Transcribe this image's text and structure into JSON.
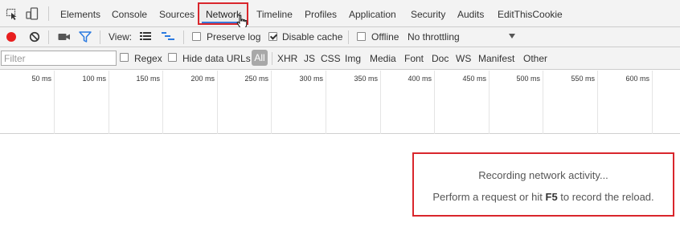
{
  "tabs": {
    "elements": "Elements",
    "console": "Console",
    "sources": "Sources",
    "network": "Network",
    "timeline": "Timeline",
    "profiles": "Profiles",
    "application": "Application",
    "security": "Security",
    "audits": "Audits",
    "editthiscookie": "EditThisCookie",
    "active": "Network"
  },
  "toolbar": {
    "view_label": "View:",
    "preserve_log": "Preserve log",
    "preserve_log_checked": false,
    "disable_cache": "Disable cache",
    "disable_cache_checked": true,
    "offline": "Offline",
    "offline_checked": false,
    "throttling": "No throttling"
  },
  "filter": {
    "placeholder": "Filter",
    "regex": "Regex",
    "hide_data_urls": "Hide data URLs",
    "types": {
      "all": "All",
      "xhr": "XHR",
      "js": "JS",
      "css": "CSS",
      "img": "Img",
      "media": "Media",
      "font": "Font",
      "doc": "Doc",
      "ws": "WS",
      "manifest": "Manifest",
      "other": "Other"
    },
    "active_type": "All"
  },
  "timeline_ticks": [
    "50 ms",
    "100 ms",
    "150 ms",
    "200 ms",
    "250 ms",
    "300 ms",
    "350 ms",
    "400 ms",
    "450 ms",
    "500 ms",
    "550 ms",
    "600 ms"
  ],
  "empty_state": {
    "line1": "Recording network activity...",
    "line2_before": "Perform a request or hit ",
    "line2_key": "F5",
    "line2_after": " to record the reload."
  },
  "colors": {
    "record": "#e81e1e",
    "highlight_box": "#d9262c",
    "active_tab_underline": "#3879d9",
    "filter_icon": "#2b7ae0",
    "toolbar_bg": "#f3f3f3"
  },
  "icons": [
    "inspect-element-icon",
    "device-mode-icon",
    "record-icon",
    "clear-icon",
    "screenshot-camera-icon",
    "filter-icon",
    "large-rows-icon",
    "waterfall-overview-icon",
    "mouse-cursor-icon"
  ]
}
